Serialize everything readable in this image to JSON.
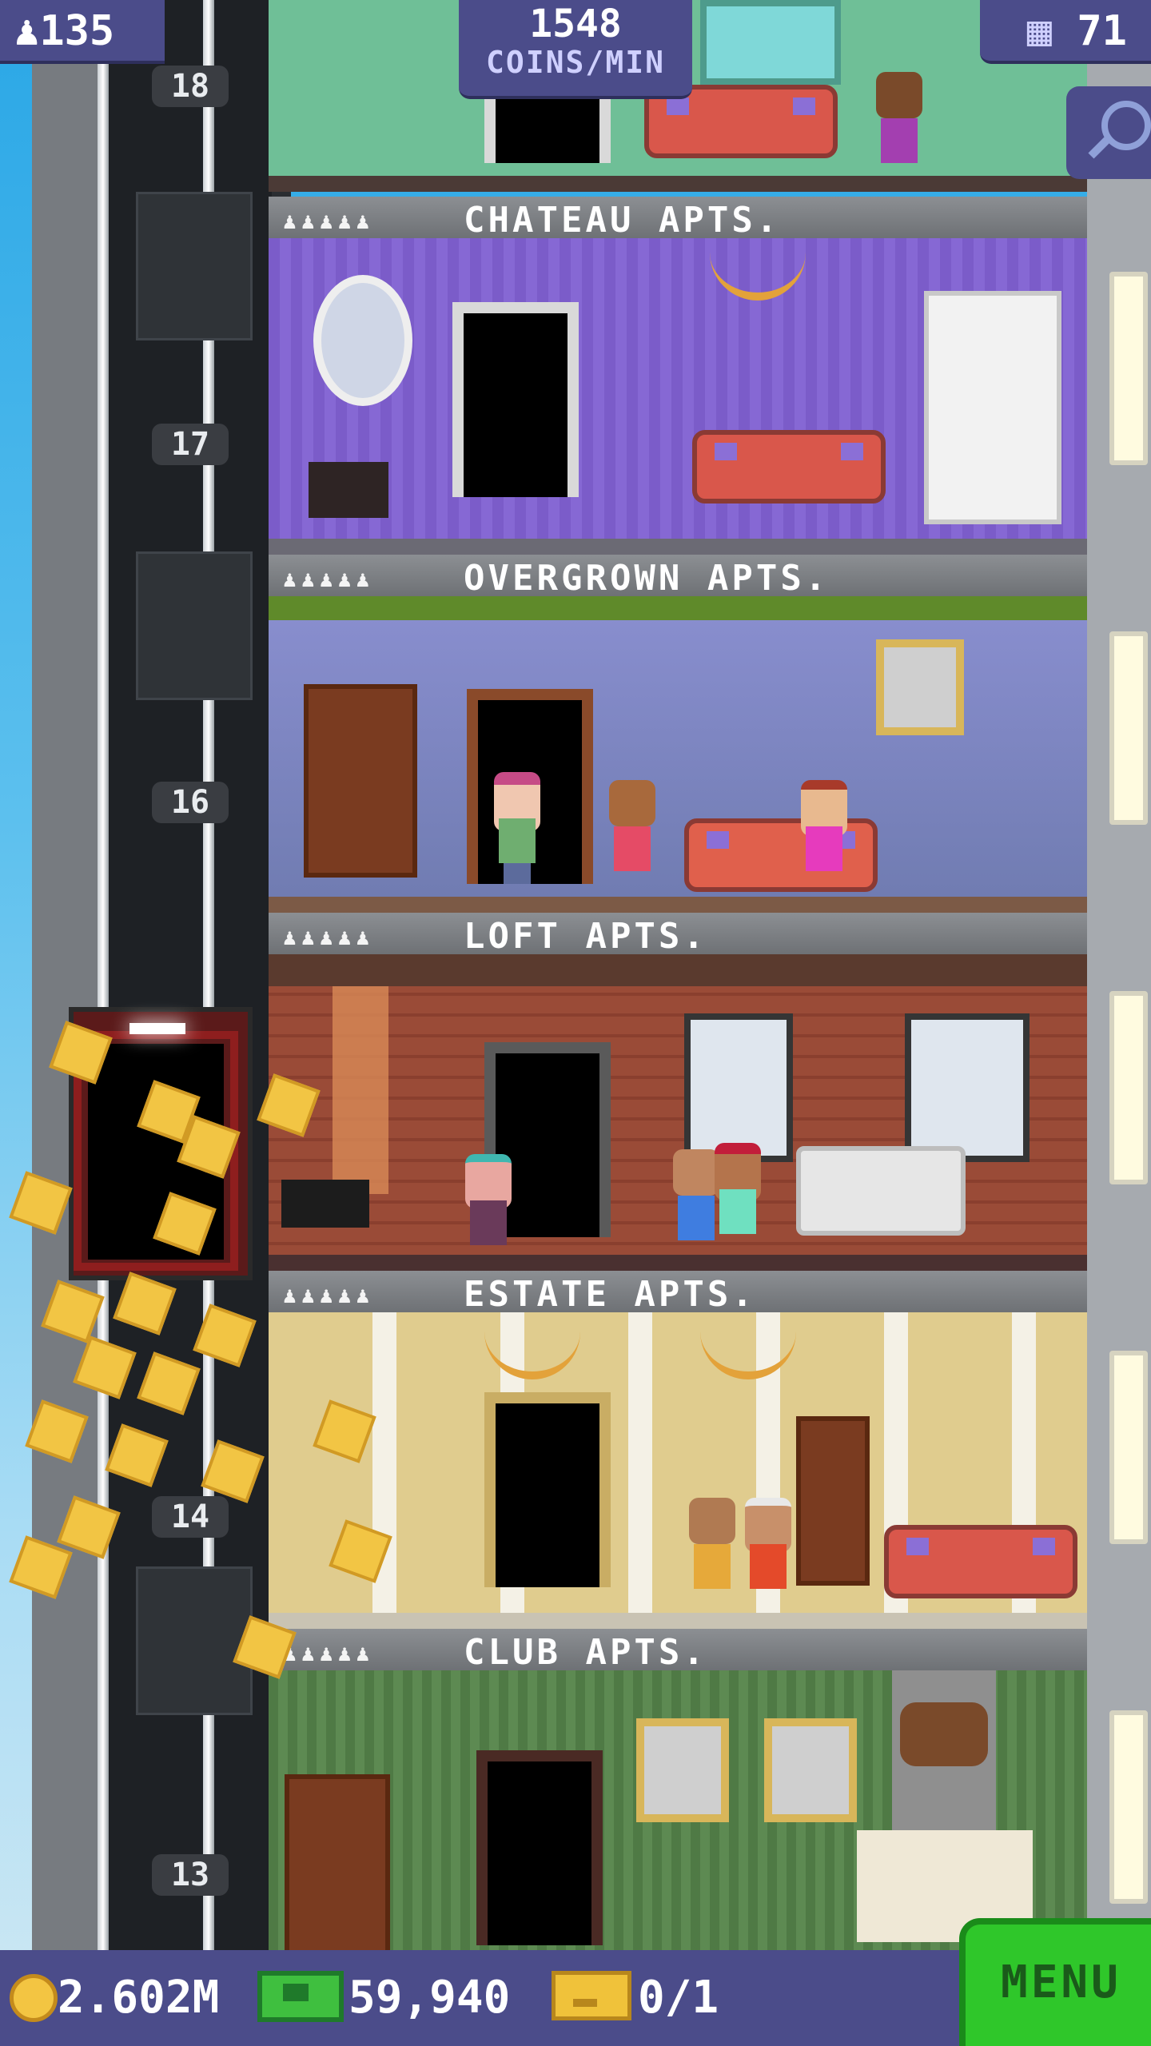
{
  "hud": {
    "population": "135",
    "coins_per_min_value": "1548",
    "coins_per_min_label": "COINS/MIN",
    "floor_count": "71"
  },
  "elevator": {
    "floor_numbers": [
      "18",
      "17",
      "16",
      "14",
      "13"
    ]
  },
  "floors": [
    {
      "name": "CHATEAU APTS.",
      "residents_icons": "♟♟♟♟♟"
    },
    {
      "name": "OVERGROWN APTS.",
      "residents_icons": "♟♟♟♟♟"
    },
    {
      "name": "LOFT APTS.",
      "residents_icons": "♟♟♟♟♟"
    },
    {
      "name": "ESTATE APTS.",
      "residents_icons": "♟♟♟♟♟"
    },
    {
      "name": "CLUB APTS.",
      "residents_icons": "♟♟♟♟♟"
    }
  ],
  "bottom": {
    "coins": "2.602M",
    "tower_bux": "59,940",
    "tickets": "0/1",
    "menu_label": "MENU"
  },
  "icons": {
    "population": "person-icon",
    "floors": "building-icon",
    "search": "magnifier-icon",
    "coins": "coin-icon",
    "bux": "cash-icon",
    "tickets": "ticket-icon"
  },
  "colors": {
    "hud_bg": "#4b4c8a",
    "menu_green": "#2fc72a",
    "coin_gold": "#f2c544"
  }
}
